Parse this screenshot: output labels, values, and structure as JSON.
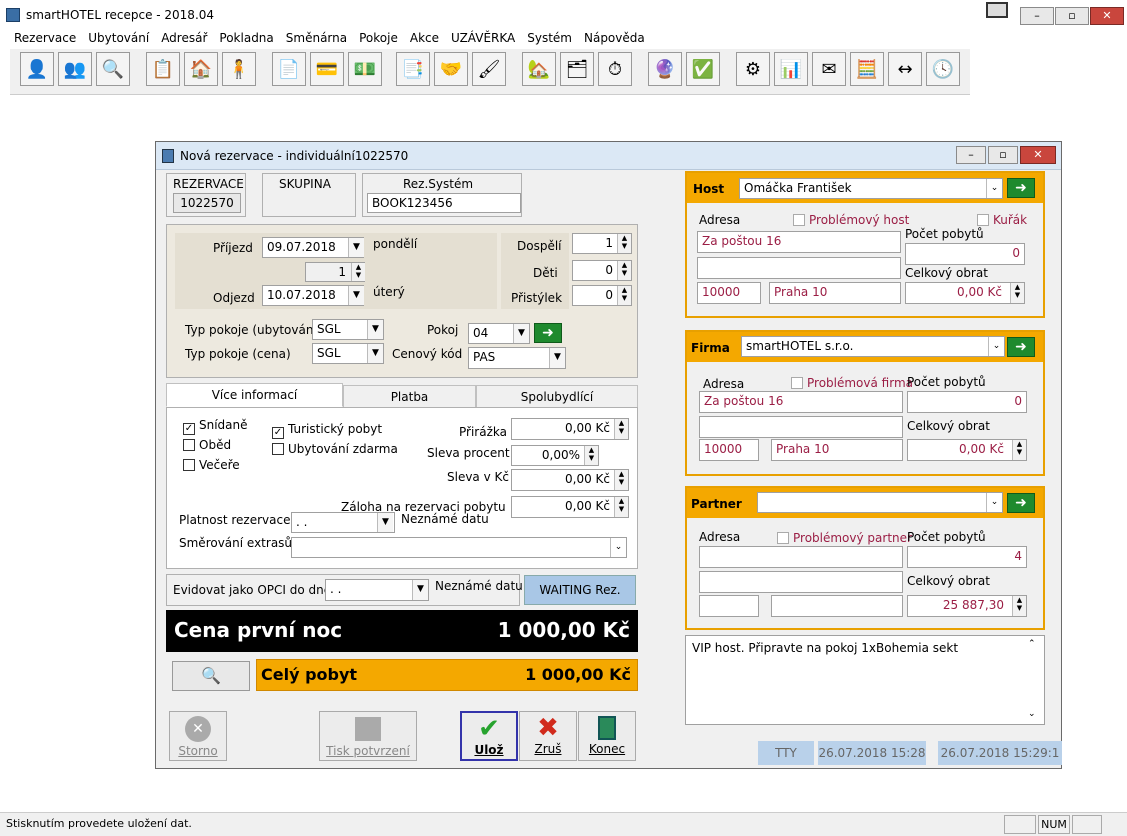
{
  "app": {
    "title": "smartHOTEL recepce - 2018.04"
  },
  "menu": [
    "Rezervace",
    "Ubytování",
    "Adresář",
    "Pokladna",
    "Směnárna",
    "Pokoje",
    "Akce",
    "UZÁVĚRKA",
    "Systém",
    "Nápověda"
  ],
  "dialog": {
    "title": "Nová rezervace - individuální1022570"
  },
  "top": {
    "rezervace_label": "REZERVACE",
    "rezervace_value": "1022570",
    "skupina_label": "SKUPINA",
    "rezsys_label": "Rez.Systém",
    "rezsys_value": "BOOK123456"
  },
  "dates": {
    "prijezd_label": "Příjezd",
    "prijezd": "09.07.2018",
    "prijezd_day": "pondělí",
    "nights": "1",
    "odjezd_label": "Odjezd",
    "odjezd": "10.07.2018",
    "odjezd_day": "úterý"
  },
  "guests": {
    "dospeli_label": "Dospělí",
    "dospeli": "1",
    "deti_label": "Děti",
    "deti": "0",
    "pristylek_label": "Přistýlek",
    "pristylek": "0"
  },
  "room": {
    "typ_ub_label": "Typ pokoje (ubytování)",
    "typ_ub": "SGL",
    "typ_cena_label": "Typ pokoje (cena)",
    "typ_cena": "SGL",
    "pokoj_label": "Pokoj",
    "pokoj": "04",
    "kod_label": "Cenový kód",
    "kod": "PAS"
  },
  "tabs": [
    "Více informací",
    "Platba",
    "Spolubydlící"
  ],
  "options": {
    "snidane": "Snídaně",
    "obed": "Oběd",
    "vecere": "Večeře",
    "turist": "Turistický pobyt",
    "zdarma": "Ubytování zdarma"
  },
  "pricing": {
    "prirazka_label": "Přirážka",
    "prirazka": "0,00 Kč",
    "sleva_proc_label": "Sleva procent",
    "sleva_proc": "0,00%",
    "sleva_kc_label": "Sleva v Kč",
    "sleva_kc": "0,00 Kč",
    "zaloha_label": "Záloha na rezervaci pobytu",
    "zaloha": "0,00 Kč"
  },
  "platnost": {
    "label": "Platnost rezervace",
    "value": ". .",
    "nezname": "Neznámé datu",
    "smerovani_label": "Směrování extrasů"
  },
  "opci": {
    "label": "Evidovat jako OPCI do dne:",
    "value": ". .",
    "nezname": "Neznámé datu",
    "waiting": "WAITING Rez."
  },
  "totals": {
    "prvni_label": "Cena první noc",
    "prvni": "1 000,00 Kč",
    "cely_label": "Celý pobyt",
    "cely": "1 000,00 Kč"
  },
  "buttons": {
    "storno": "Storno",
    "tisk": "Tisk potvrzení",
    "uloz": "Ulož",
    "zrus": "Zruš",
    "konec": "Konec"
  },
  "host": {
    "label": "Host",
    "name": "Omáčka František",
    "adresa_label": "Adresa",
    "problem": "Problémový host",
    "kurak": "Kuřák",
    "street": "Za poštou 16",
    "zip": "10000",
    "city": "Praha 10",
    "pocet_label": "Počet pobytů",
    "pocet": "0",
    "obrat_label": "Celkový obrat",
    "obrat": "0,00 Kč"
  },
  "firma": {
    "label": "Firma",
    "name": "smartHOTEL s.r.o.",
    "adresa_label": "Adresa",
    "problem": "Problémová firma",
    "street": "Za poštou 16",
    "zip": "10000",
    "city": "Praha 10",
    "pocet_label": "Počet pobytů",
    "pocet": "0",
    "obrat_label": "Celkový obrat",
    "obrat": "0,00 Kč"
  },
  "partner": {
    "label": "Partner",
    "name": "",
    "adresa_label": "Adresa",
    "problem": "Problémový partner",
    "pocet_label": "Počet pobytů",
    "pocet": "4",
    "obrat_label": "Celkový obrat",
    "obrat": "25 887,30"
  },
  "note": "VIP host. Připravte na pokoj 1xBohemia sekt",
  "footer": {
    "tty": "TTY",
    "created": "26.07.2018 15:28",
    "modified": "26.07.2018 15:29:1"
  },
  "status": {
    "text": "Stisknutím provedete uložení dat.",
    "num": "NUM"
  },
  "colors": {
    "accent": "#f4a800",
    "dark": "#000000",
    "green": "#1f8a2e"
  }
}
